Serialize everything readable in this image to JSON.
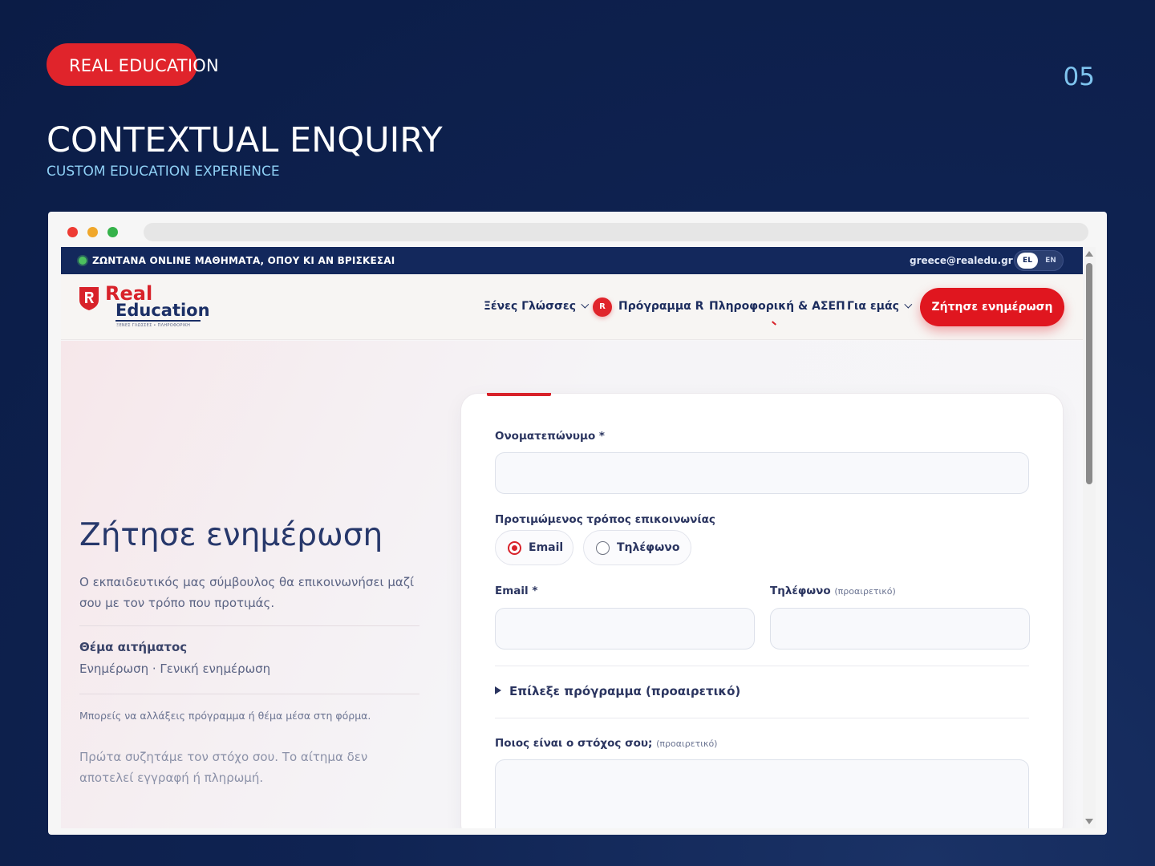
{
  "slide": {
    "brand": "REAL EDUCATION",
    "number": "05",
    "title": "CONTEXTUAL ENQUIRY",
    "subtitle": "CUSTOM EDUCATION EXPERIENCE"
  },
  "colors": {
    "background": "#0f2352",
    "brand_red": "#e0242b",
    "navy": "#13285c",
    "accent_blue": "#7fc4ef"
  },
  "topbar": {
    "announcement": "ΖΩΝΤΑΝΑ ONLINE ΜΑΘΗΜΑΤΑ, ΟΠΟΥ ΚΙ ΑΝ ΒΡΙΣΚΕΣΑΙ",
    "email": "greece@realedu.gr",
    "lang_active": "EL",
    "lang_other": "EN"
  },
  "navbar": {
    "logo_real": "Real",
    "logo_education": "Education",
    "logo_tagline": "ΞΕΝΕΣ ΓΛΩΣΣΕΣ • ΠΛΗΡΟΦΟΡΙΚΗ",
    "logo_icon": "r-shield-icon",
    "items": [
      {
        "label": "Ξένες Γλώσσες",
        "has_dropdown": true
      },
      {
        "label": "Πρόγραμμα R",
        "badge": "R"
      },
      {
        "label": "Πληροφορική & ΑΣΕΠ"
      },
      {
        "label": "Για εμάς",
        "has_dropdown": true
      }
    ],
    "cta": "Ζήτησε ενημέρωση"
  },
  "left": {
    "title": "Ζήτησε ενημέρωση",
    "description": "Ο εκπαιδευτικός μας σύμβουλος θα επικοινωνήσει μαζί σου με τον τρόπο που προτιμάς.",
    "topic_label": "Θέμα αιτήματος",
    "topic_value": "Ενημέρωση · Γενική ενημέρωση",
    "note_small": "Μπορείς να αλλάξεις πρόγραμμα ή θέμα μέσα στη φόρμα.",
    "note_large": "Πρώτα συζητάμε τον στόχο σου. Το αίτημα δεν αποτελεί εγγραφή ή πληρωμή."
  },
  "form": {
    "fullname_label": "Ονοματεπώνυμο *",
    "fullname_value": "",
    "contact_pref_label": "Προτιμώμενος τρόπος επικοινωνίας",
    "contact_options": [
      {
        "label": "Email",
        "checked": true
      },
      {
        "label": "Τηλέφωνο",
        "checked": false
      }
    ],
    "email_label": "Email *",
    "email_value": "",
    "phone_label": "Τηλέφωνο",
    "phone_optional": "(προαιρετικό)",
    "phone_value": "",
    "program_disclosure": "Επίλεξε πρόγραμμα (προαιρετικό)",
    "goal_label": "Ποιος είναι ο στόχος σου;",
    "goal_optional": "(προαιρετικό)",
    "goal_value": ""
  }
}
